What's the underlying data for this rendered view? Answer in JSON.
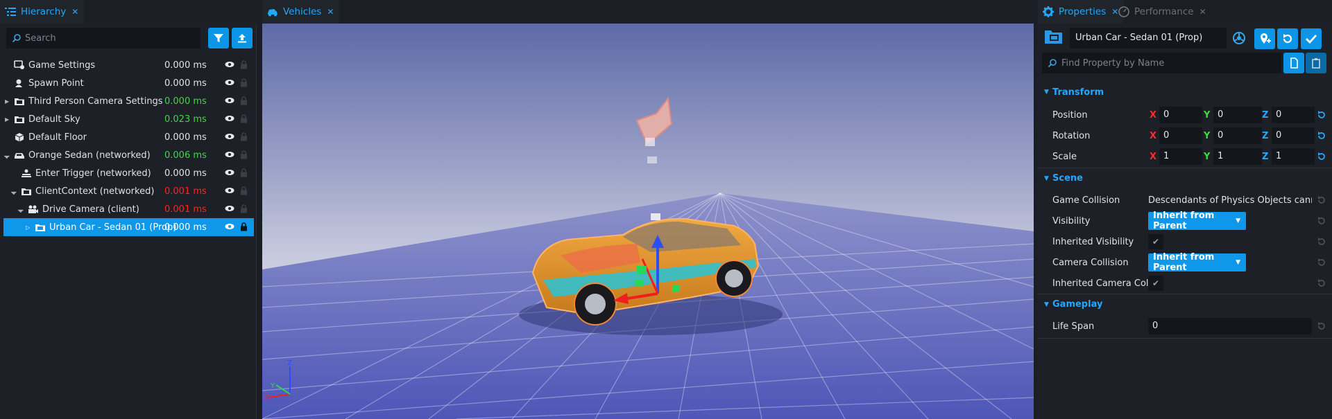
{
  "tabs": {
    "hierarchy": "Hierarchy",
    "vehicles": "Vehicles",
    "properties": "Properties",
    "performance": "Performance"
  },
  "hierarchy": {
    "search_placeholder": "Search",
    "rows": [
      {
        "name": "Game Settings",
        "ms": "0.000 ms",
        "ms_color": "normal",
        "icon": "settings-icon"
      },
      {
        "name": "Spawn Point",
        "ms": "0.000 ms",
        "ms_color": "normal",
        "icon": "spawn-icon"
      },
      {
        "name": "Third Person Camera Settings",
        "ms": "0.000 ms",
        "ms_color": "green",
        "icon": "folder-icon"
      },
      {
        "name": "Default Sky",
        "ms": "0.023 ms",
        "ms_color": "green",
        "icon": "folder-icon"
      },
      {
        "name": "Default Floor",
        "ms": "0.000 ms",
        "ms_color": "normal",
        "icon": "cube-icon"
      },
      {
        "name": "Orange Sedan (networked)",
        "ms": "0.006 ms",
        "ms_color": "green",
        "icon": "vehicle-icon"
      },
      {
        "name": "Enter Trigger (networked)",
        "ms": "0.000 ms",
        "ms_color": "normal",
        "icon": "trigger-icon"
      },
      {
        "name": "ClientContext (networked)",
        "ms": "0.001 ms",
        "ms_color": "red",
        "icon": "folder-icon"
      },
      {
        "name": "Drive Camera (client)",
        "ms": "0.001 ms",
        "ms_color": "red",
        "icon": "camera-icon"
      },
      {
        "name": "Urban Car - Sedan 01 (Prop)",
        "ms": "0.000 ms",
        "ms_color": "normal",
        "icon": "folder-icon"
      }
    ]
  },
  "properties": {
    "object_name": "Urban Car - Sedan 01 (Prop)",
    "find_placeholder": "Find Property by Name",
    "transform": {
      "title": "Transform",
      "position": {
        "label": "Position",
        "x": "0",
        "y": "0",
        "z": "0"
      },
      "rotation": {
        "label": "Rotation",
        "x": "0",
        "y": "0",
        "z": "0"
      },
      "scale": {
        "label": "Scale",
        "x": "1",
        "y": "1",
        "z": "1"
      }
    },
    "axes": {
      "x": "X",
      "y": "Y",
      "z": "Z"
    },
    "scene": {
      "title": "Scene",
      "game_collision_label": "Game Collision",
      "game_collision_value": "Descendants of Physics Objects cannot h",
      "visibility_label": "Visibility",
      "visibility_value": "Inherit from Parent",
      "inherited_visibility_label": "Inherited Visibility",
      "camera_collision_label": "Camera Collision",
      "camera_collision_value": "Inherit from Parent",
      "inherited_camera_label": "Inherited Camera Col"
    },
    "gameplay": {
      "title": "Gameplay",
      "life_span_label": "Life Span",
      "life_span_value": "0"
    }
  },
  "colors": {
    "accent": "#0f97ea",
    "x_axis": "#ff2b2b",
    "y_axis": "#43d645",
    "z_axis": "#24a8ff"
  }
}
